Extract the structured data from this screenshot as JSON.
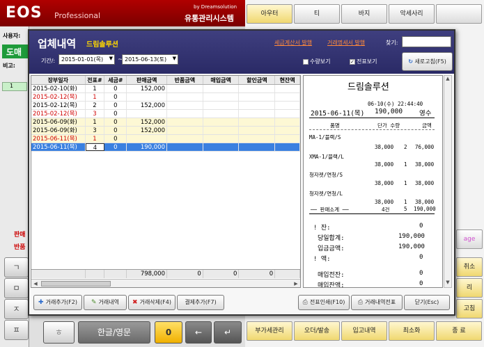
{
  "app": {
    "logo": "EOS",
    "edition": "Professional",
    "by": "by Dreamsolution",
    "system_name": "유통관리시스템"
  },
  "left_panel": {
    "user_label": "사용자:",
    "role_button": "도매",
    "memo_label": "비고:",
    "row_num": "1",
    "sales_label": "판매",
    "return_label": "반품"
  },
  "keypad": [
    "ㄱ",
    "ㅁ",
    "ㅈ",
    "ㅍ",
    "ㅎ"
  ],
  "bottom_bar": {
    "lang_toggle": "한글/영문",
    "zero": "0",
    "back": "←",
    "enter": "↵"
  },
  "right_menu": {
    "top": [
      "아우터",
      "티",
      "바지",
      "악세사리"
    ],
    "right_col": [
      "age",
      "취소",
      "리",
      "고침"
    ],
    "bottom": [
      "부가세관리",
      "오더/발송",
      "입고내역",
      "최소화",
      "종   료"
    ]
  },
  "dialog": {
    "title": "업체내역",
    "company": "드림솔루션",
    "links": [
      "세금계산서 발행",
      "거래명세서 발행"
    ],
    "search_label": "찾기:",
    "search_value": "",
    "period_label": "기간/:",
    "date_from": "2015-01-01(목)",
    "date_to": "2015-06-13(토)",
    "tilde": "~",
    "show_qty": "수량보기",
    "show_qty_checked": false,
    "show_slip": "전표보기",
    "show_slip_checked": true,
    "refresh": "새로고침(F5)"
  },
  "table": {
    "columns": [
      "장부일자",
      "전표#",
      "세금#",
      "판매금액",
      "반품금액",
      "매입금액",
      "할인금액",
      "현잔액"
    ],
    "rows": [
      {
        "date": "2015-02-10(화)",
        "slip": "1",
        "tax": "0",
        "sale": "152,000",
        "red": false,
        "bg": "white"
      },
      {
        "date": "2015-02-12(목)",
        "slip": "1",
        "tax": "0",
        "sale": "",
        "red": true,
        "bg": "white"
      },
      {
        "date": "2015-02-12(목)",
        "slip": "2",
        "tax": "0",
        "sale": "152,000",
        "red": false,
        "bg": "white"
      },
      {
        "date": "2015-02-12(목)",
        "slip": "3",
        "tax": "0",
        "sale": "",
        "red": true,
        "bg": "white"
      },
      {
        "date": "2015-06-09(화)",
        "slip": "1",
        "tax": "0",
        "sale": "152,000",
        "red": false,
        "bg": "yellow"
      },
      {
        "date": "2015-06-09(화)",
        "slip": "3",
        "tax": "0",
        "sale": "152,000",
        "red": false,
        "bg": "yellow"
      },
      {
        "date": "2015-06-11(목)",
        "slip": "1",
        "tax": "0",
        "sale": "",
        "red": true,
        "bg": "yellow"
      },
      {
        "date": "2015-06-11(목)",
        "slip": "4",
        "tax": "0",
        "sale": "190,000",
        "red": false,
        "bg": "selected"
      }
    ],
    "totals": {
      "sale": "798,000",
      "ret": "0",
      "buy": "0",
      "disc": "0"
    }
  },
  "receipt": {
    "title": "드림솔루션",
    "datetime": "06-10(수) 22:44:40",
    "date": "2015-06-11(목)",
    "amount": "190,000",
    "kind": "영수",
    "head": {
      "item": "품명",
      "price": "단가 수량",
      "total": "금액"
    },
    "items": [
      {
        "name": "MA-1/블랙/S",
        "price": "38,000",
        "qty": "2",
        "sum": "76,000"
      },
      {
        "name": "XMA-1/블랙/L",
        "price": "38,000",
        "qty": "1",
        "sum": "38,000"
      },
      {
        "name": "청자켓/연청/S",
        "price": "38,000",
        "qty": "1",
        "sum": "38,000"
      },
      {
        "name": "청자켓/연청/L",
        "price": "38,000",
        "qty": "1",
        "sum": "38,000"
      }
    ],
    "subtotal": {
      "label": "── 판매소계 ──",
      "count": "4건",
      "qty": "5",
      "sum": "190,000"
    },
    "balance": {
      "label": "!     잔:",
      "value": "0"
    },
    "day_total": {
      "label": "당일합계:",
      "value": "190,000"
    },
    "deposit": {
      "label": "입금금액:",
      "value": "190,000"
    },
    "debt": {
      "label": "!     액:",
      "value": "0"
    },
    "prev_buy": {
      "label": "매입전잔:",
      "value": "0"
    },
    "buy_bal": {
      "label": "매입잔액:",
      "value": "0"
    }
  },
  "footer_buttons": {
    "add": "거래추가(F2)",
    "history": "거래내역",
    "delete": "거래삭제(F4)",
    "settle": "결제추가(F7)",
    "print_slip": "전표인쇄(F10)",
    "print_history": "거래내역전표",
    "close": "닫기(Esc)"
  }
}
